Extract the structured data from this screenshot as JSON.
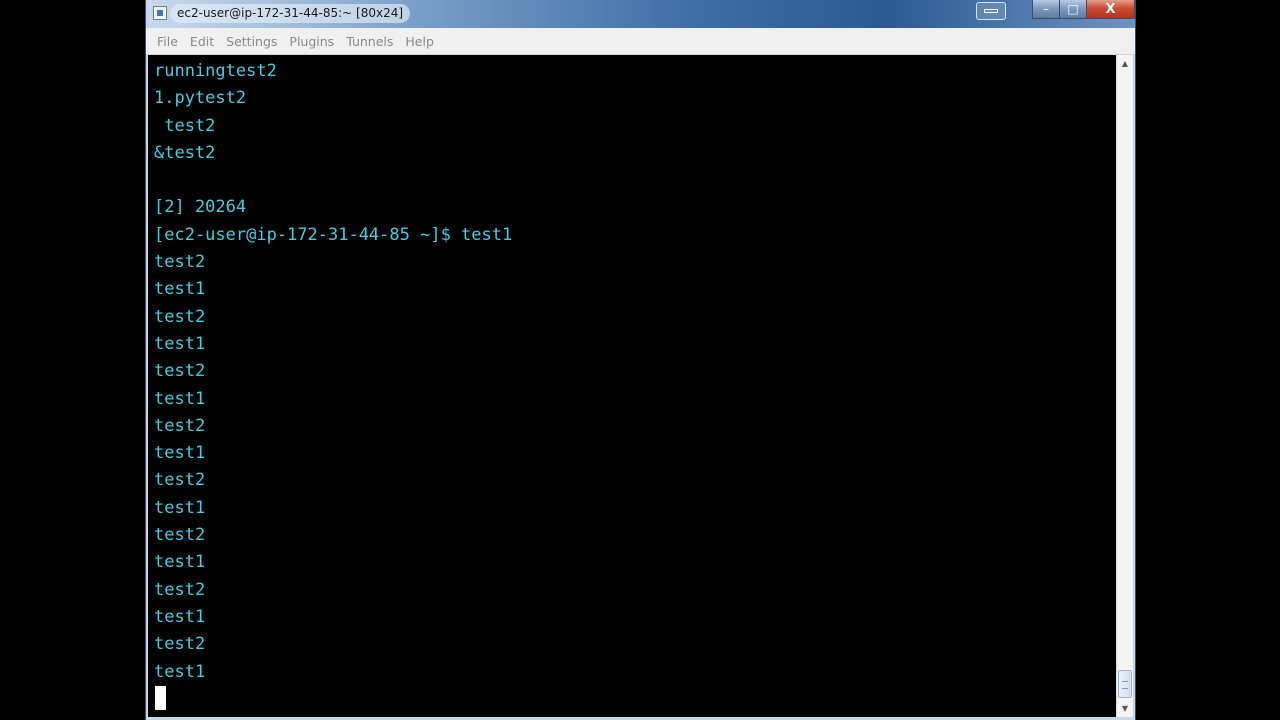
{
  "window": {
    "title": "ec2-user@ip-172-31-44-85:~ [80x24]",
    "close_label": "X"
  },
  "menu": {
    "items": [
      {
        "label": "File"
      },
      {
        "label": "Edit"
      },
      {
        "label": "Settings"
      },
      {
        "label": "Plugins"
      },
      {
        "label": "Tunnels"
      },
      {
        "label": "Help"
      }
    ]
  },
  "terminal": {
    "lines": [
      "runningtest2",
      "1.pytest2",
      " test2",
      "&test2",
      "",
      "[2] 20264",
      "[ec2-user@ip-172-31-44-85 ~]$ test1",
      "test2",
      "test1",
      "test2",
      "test1",
      "test2",
      "test1",
      "test2",
      "test1",
      "test2",
      "test1",
      "test2",
      "test1",
      "test2",
      "test1",
      "test2",
      "test1"
    ]
  },
  "colors": {
    "terminal_text": "#3ed0e4",
    "terminal_background": "#000000",
    "close_button": "#c7462b"
  },
  "icons": {
    "app": "terminal-app-icon",
    "close": "close-icon",
    "scroll_up": "scroll-up-arrow-icon",
    "scroll_down": "scroll-down-arrow-icon"
  }
}
